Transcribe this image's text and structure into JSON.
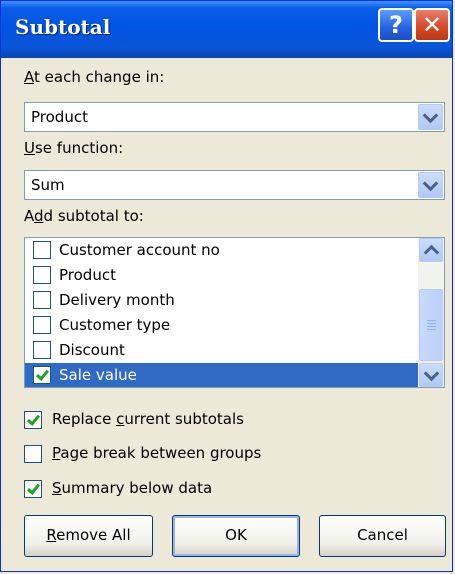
{
  "dialog": {
    "title": "Subtotal",
    "help_glyph": "?",
    "close_glyph": "✕"
  },
  "group_by": {
    "label_access": "A",
    "label_rest": "t each change in:",
    "value": "Product"
  },
  "function": {
    "label_access": "U",
    "label_rest": "se function:",
    "value": "Sum"
  },
  "add_subtotal": {
    "label_pre": "A",
    "label_access": "d",
    "label_rest": "d subtotal to:",
    "items": [
      {
        "label": "Customer account no",
        "checked": false,
        "selected": false
      },
      {
        "label": "Product",
        "checked": false,
        "selected": false
      },
      {
        "label": "Delivery month",
        "checked": false,
        "selected": false
      },
      {
        "label": "Customer type",
        "checked": false,
        "selected": false
      },
      {
        "label": "Discount",
        "checked": false,
        "selected": false
      },
      {
        "label": "Sale value",
        "checked": true,
        "selected": true
      }
    ]
  },
  "options": {
    "replace": {
      "pre": "Replace ",
      "access": "c",
      "rest": "urrent subtotals",
      "checked": true
    },
    "page_break": {
      "pre": "",
      "access": "P",
      "rest": "age break between groups",
      "checked": false
    },
    "summary": {
      "pre": "",
      "access": "S",
      "rest": "ummary below data",
      "checked": true
    }
  },
  "buttons": {
    "remove_access": "R",
    "remove_rest": "emove All",
    "ok": "OK",
    "cancel": "Cancel"
  },
  "colors": {
    "titlebar": "#0054e3",
    "selection": "#316ac5",
    "check": "#21a121",
    "close": "#d84a2a"
  }
}
